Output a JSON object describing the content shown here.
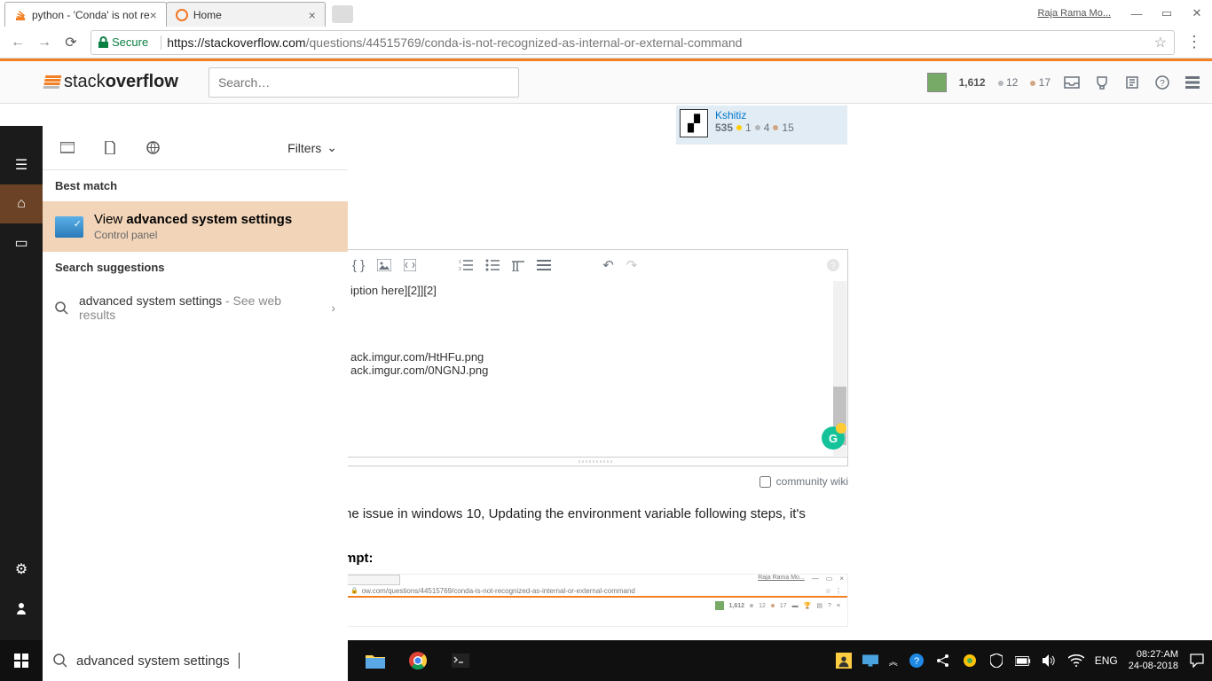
{
  "browser": {
    "tabs": [
      {
        "title": "python - 'Conda' is not re",
        "active": true,
        "icon": "so"
      },
      {
        "title": "Home",
        "active": false,
        "icon": "jupyter"
      }
    ],
    "user": "Raja Rama Mo...",
    "url": {
      "secure": "Secure",
      "host": "https://stackoverflow.com",
      "path": "/questions/44515769/conda-is-not-recognized-as-internal-or-external-command"
    }
  },
  "so": {
    "search_placeholder": "Search…",
    "rep": "1,612",
    "silver": "12",
    "bronze": "17",
    "user": {
      "name": "Kshitiz",
      "rep": "535",
      "gold": "1",
      "silver": "4",
      "bronze": "15"
    },
    "editor_snip": "iption here][2]][2]",
    "links": [
      "ack.imgur.com/HtHFu.png",
      "ack.imgur.com/0NGNJ.png"
    ],
    "cw_label": "community wiki",
    "body": "ne issue in windows 10, Updating the environment variable following steps, it's",
    "heading": "mpt:",
    "inner_url": "ow.com/questions/44515769/conda-is-not-recognized-as-internal-or-external-command",
    "inner_rep": "1,612",
    "inner_s": "12",
    "inner_b": "17"
  },
  "search": {
    "filters": "Filters",
    "best_label": "Best match",
    "best": {
      "pre": "View ",
      "bold": "advanced system settings",
      "sub": "Control panel"
    },
    "sugg_label": "Search suggestions",
    "sugg": {
      "text": "advanced system settings",
      "tail": " - See web results"
    },
    "input": "advanced system settings"
  },
  "tray": {
    "lang": "ENG",
    "time": "08:27:AM",
    "date": "24-08-2018"
  }
}
